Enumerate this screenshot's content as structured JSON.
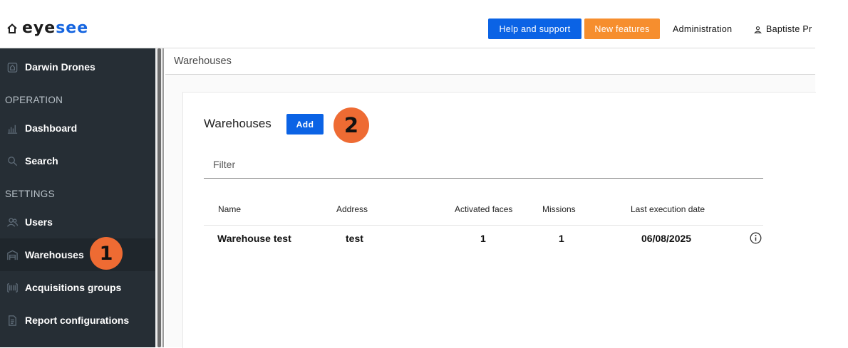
{
  "header": {
    "logo_left": "eye",
    "logo_right": "see",
    "help_label": "Help and support",
    "new_features_label": "New features",
    "admin_label": "Administration",
    "user_label": "Baptiste Pr"
  },
  "sidebar": {
    "org": "Darwin Drones",
    "section_operation": "OPERATION",
    "dashboard": "Dashboard",
    "search": "Search",
    "section_settings": "SETTINGS",
    "users": "Users",
    "warehouses": "Warehouses",
    "acquisitions": "Acquisitions groups",
    "reports": "Report configurations"
  },
  "breadcrumb": "Warehouses",
  "main": {
    "title": "Warehouses",
    "add_label": "Add",
    "filter_placeholder": "Filter",
    "columns": [
      "Name",
      "Address",
      "Activated faces",
      "Missions",
      "Last execution date"
    ],
    "rows": [
      [
        "Warehouse test",
        "test",
        "1",
        "1",
        "06/08/2025"
      ]
    ]
  },
  "badges": [
    "1",
    "2"
  ],
  "colors": {
    "primary": "#0b63e5",
    "orange": "#f68e2e",
    "sidebar": "#262e35",
    "badge": "#ee6b33"
  }
}
